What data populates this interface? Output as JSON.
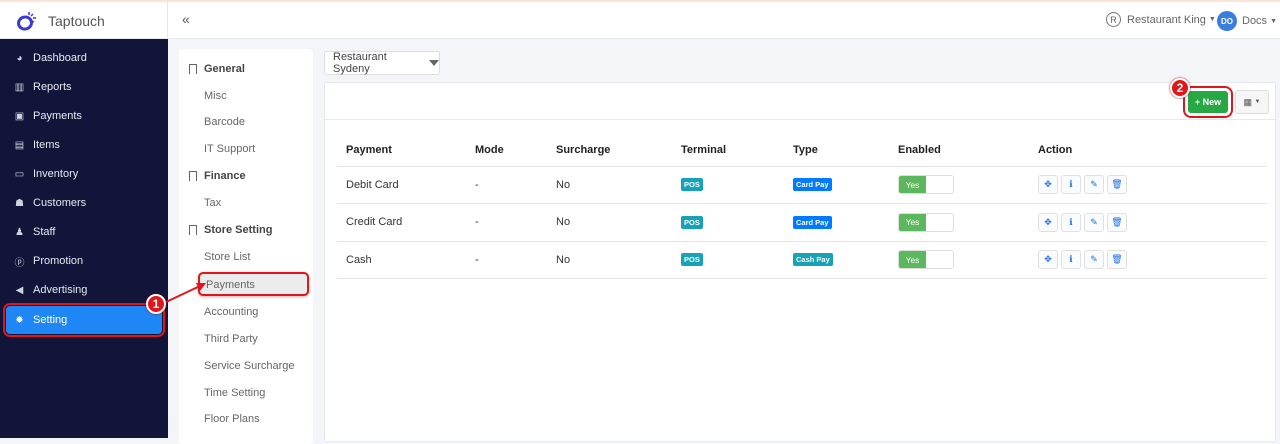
{
  "app": {
    "name": "Taptouch",
    "collapse_icon": "double-chevron-left"
  },
  "header": {
    "restaurant": "Restaurant King",
    "restaurant_icon": "R",
    "user_initials": "DO",
    "user_name": "Docs"
  },
  "sidebar": {
    "items": [
      {
        "label": "Dashboard",
        "icon": "tachometer"
      },
      {
        "label": "Reports",
        "icon": "bar-chart"
      },
      {
        "label": "Payments",
        "icon": "money"
      },
      {
        "label": "Items",
        "icon": "book"
      },
      {
        "label": "Inventory",
        "icon": "inbox"
      },
      {
        "label": "Customers",
        "icon": "users"
      },
      {
        "label": "Staff",
        "icon": "user-tie"
      },
      {
        "label": "Promotion",
        "icon": "product-hunt"
      },
      {
        "label": "Advertising",
        "icon": "bullhorn"
      },
      {
        "label": "Setting",
        "icon": "gear",
        "active": true
      }
    ]
  },
  "settings_menu": {
    "sections": [
      {
        "title": "General",
        "items": [
          "Misc",
          "Barcode",
          "IT Support"
        ]
      },
      {
        "title": "Finance",
        "items": [
          "Tax"
        ]
      },
      {
        "title": "Store Setting",
        "items": [
          "Store List",
          "Payments",
          "Accounting",
          "Third Party",
          "Service Surcharge",
          "Time Setting",
          "Floor Plans"
        ]
      }
    ],
    "selected": "Payments"
  },
  "store_select": {
    "value": "Restaurant Sydeny"
  },
  "toolbar": {
    "new_label": "+ New",
    "columns_icon": "table-columns"
  },
  "table": {
    "headers": [
      "Payment",
      "Mode",
      "Surcharge",
      "Terminal",
      "Type",
      "Enabled",
      "Action"
    ],
    "rows": [
      {
        "payment": "Debit Card",
        "mode": "-",
        "surcharge": "No",
        "terminal": "POS",
        "type": "Card Pay",
        "enabled": "Yes"
      },
      {
        "payment": "Credit Card",
        "mode": "-",
        "surcharge": "No",
        "terminal": "POS",
        "type": "Card Pay",
        "enabled": "Yes"
      },
      {
        "payment": "Cash",
        "mode": "-",
        "surcharge": "No",
        "terminal": "POS",
        "type": "Cash Pay",
        "enabled": "Yes"
      }
    ]
  },
  "annotations": {
    "step1": "1",
    "step2": "2"
  },
  "colors": {
    "sidebar": "#12143a",
    "active": "#1e87f5",
    "new": "#28a745",
    "pos": "#17a2b8",
    "card_pay": "#007bff",
    "cash_pay": "#17a2b8",
    "toggle": "#5cb85c",
    "annotation": "#e0161b"
  }
}
